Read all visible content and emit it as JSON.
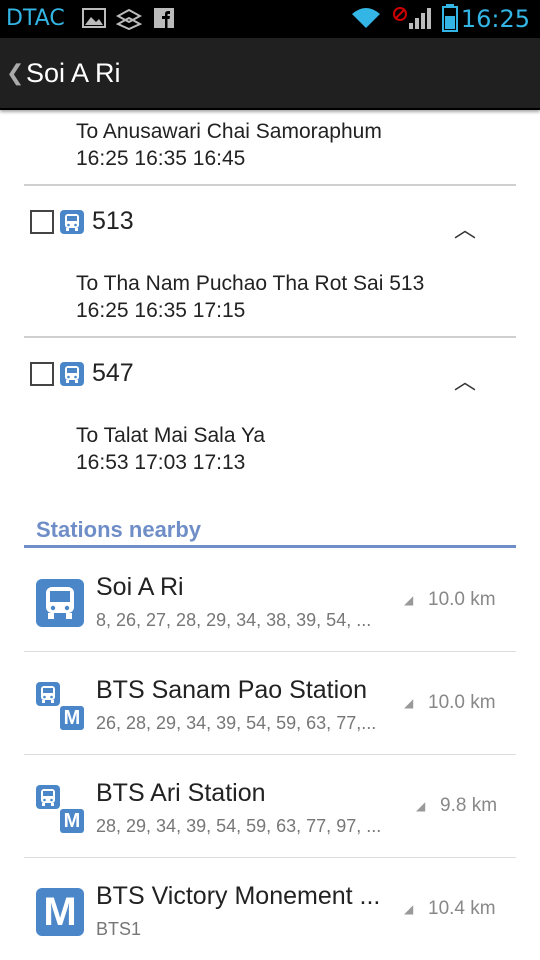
{
  "status_bar": {
    "carrier": "DTAC",
    "time": "16:25",
    "icons": [
      "image-icon",
      "dropbox-icon",
      "facebook-icon",
      "wifi-icon",
      "no-data-icon",
      "signal-icon",
      "battery-icon"
    ]
  },
  "action_bar": {
    "title": "Soi A Ri",
    "back_icon": "chevron-left-icon"
  },
  "routes": [
    {
      "destination": "To Anusawari Chai Samoraphum",
      "times": "16:25 16:35 16:45"
    },
    {
      "number": "513",
      "destination": "To Tha Nam Puchao Tha Rot Sai 513",
      "times": "16:25 16:35 17:15",
      "checked": false
    },
    {
      "number": "547",
      "destination": "To Talat Mai Sala Ya",
      "times": "16:53 17:03 17:13",
      "checked": false
    }
  ],
  "stations_nearby": {
    "title": "Stations nearby",
    "items": [
      {
        "name": "Soi A Ri",
        "lines": "8, 26, 27, 28, 29, 34, 38, 39, 54, ...",
        "distance": "10.0 km",
        "icon": "bus-stop-icon"
      },
      {
        "name": "BTS Sanam Pao Station",
        "lines": "26, 28, 29, 34, 39, 54, 59, 63, 77,...",
        "distance": "10.0 km",
        "icon": "bus-and-metro-icon",
        "metro_letter": "M"
      },
      {
        "name": "BTS Ari Station",
        "lines": "28, 29, 34, 39, 54, 59, 63, 77, 97, ...",
        "distance": "9.8 km",
        "icon": "bus-and-metro-icon",
        "metro_letter": "M"
      },
      {
        "name": "BTS Victory Monement ...",
        "lines": "BTS1",
        "distance": "10.4 km",
        "icon": "metro-icon",
        "metro_letter": "M"
      }
    ]
  },
  "colors": {
    "accent": "#33b5e5",
    "section": "#6f8ec8",
    "icon_blue": "#4a86c8"
  }
}
